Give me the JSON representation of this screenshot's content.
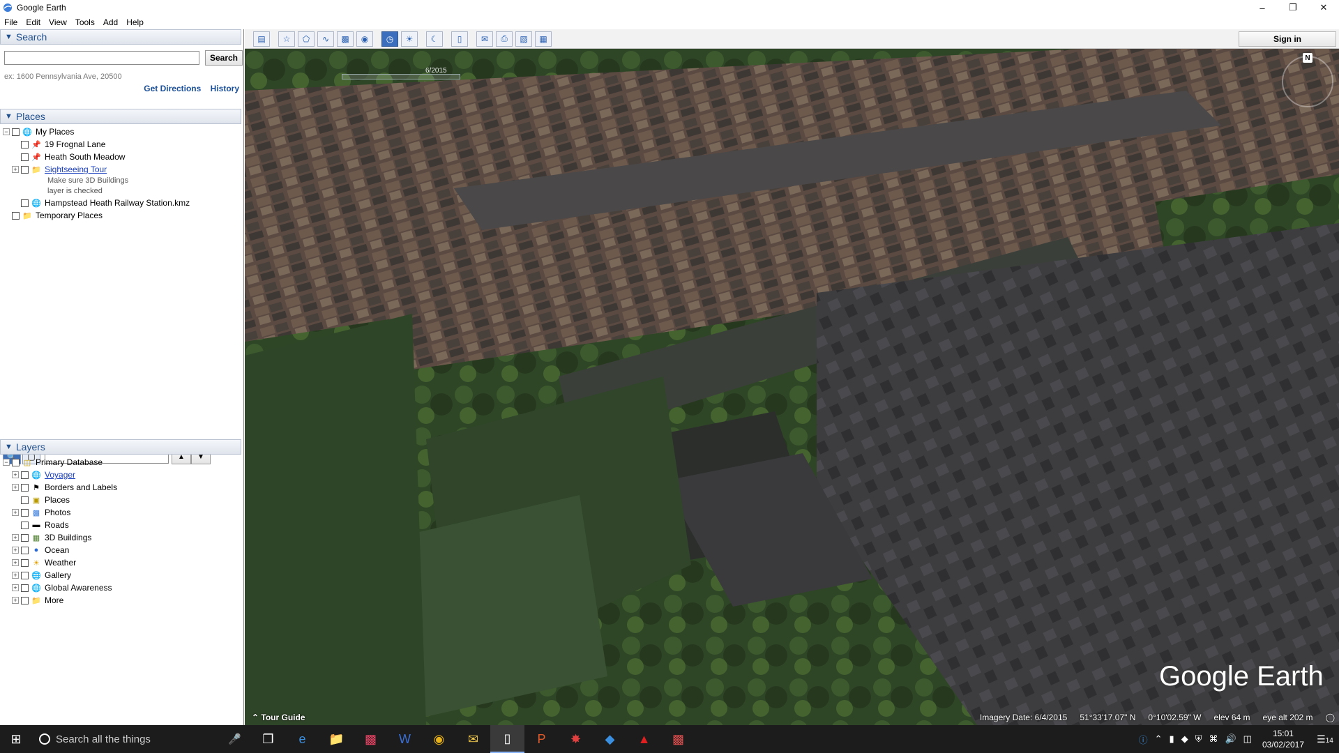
{
  "window": {
    "title": "Google Earth"
  },
  "menu": [
    "File",
    "Edit",
    "View",
    "Tools",
    "Add",
    "Help"
  ],
  "search": {
    "header": "Search",
    "button": "Search",
    "hint": "ex: 1600 Pennsylvania Ave, 20500",
    "get_directions": "Get Directions",
    "history": "History"
  },
  "places": {
    "header": "Places",
    "my_places": "My Places",
    "items": [
      "19 Frognal Lane",
      "Heath South Meadow",
      "Sightseeing Tour"
    ],
    "sightseeing_note_1": "Make sure 3D Buildings",
    "sightseeing_note_2": "layer is checked",
    "kmz": "Hampstead Heath Railway Station.kmz",
    "temporary": "Temporary Places"
  },
  "layers": {
    "header": "Layers",
    "root": "Primary Database",
    "items": [
      "Voyager",
      "Borders and Labels",
      "Places",
      "Photos",
      "Roads",
      "3D Buildings",
      "Ocean",
      "Weather",
      "Gallery",
      "Global Awareness",
      "More"
    ]
  },
  "toolbar": {
    "sign_in": "Sign in"
  },
  "map": {
    "time_label": "6/2015",
    "compass_n": "N",
    "brand": "Google Earth",
    "tour_guide": "Tour Guide",
    "imagery_date": "Imagery Date: 6/4/2015",
    "lat": "51°33'17.07\" N",
    "lon": "0°10'02.59\" W",
    "elev": "elev    64 m",
    "eye_alt": "eye alt    202 m"
  },
  "taskbar": {
    "search_placeholder": "Search all the things",
    "time": "15:01",
    "date": "03/02/2017",
    "notifications": "14"
  }
}
